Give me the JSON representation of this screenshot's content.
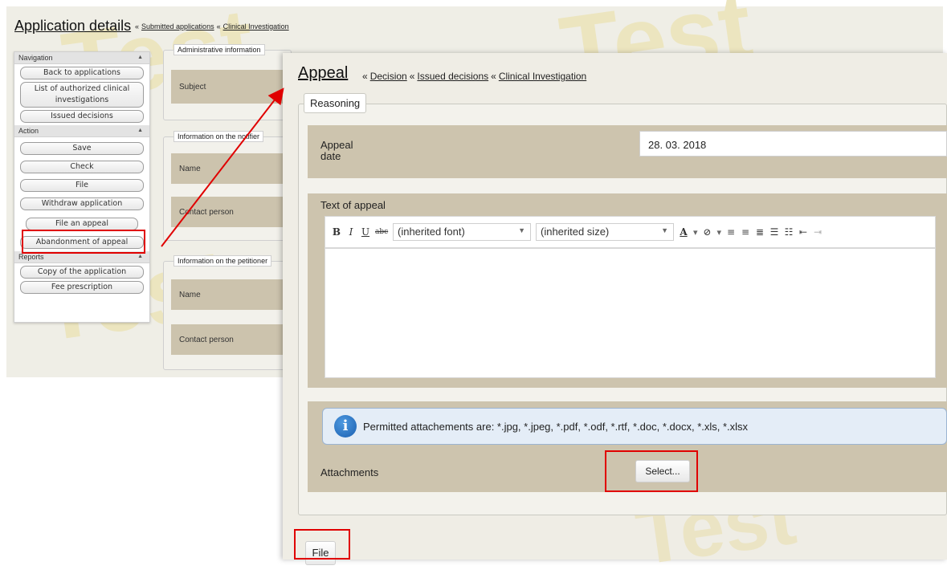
{
  "watermark_text": "Test",
  "app": {
    "title": "Application details",
    "breadcrumbs": [
      "Submitted applications",
      "Clinical Investigation"
    ]
  },
  "sidebar": {
    "sections": [
      {
        "label": "Navigation",
        "buttons": [
          "Back to applications",
          "List of authorized clinical investigations",
          "Issued decisions"
        ]
      },
      {
        "label": "Action",
        "buttons": [
          "Save",
          "Check",
          "File",
          "Withdraw application",
          "File an appeal",
          "Abandonment of appeal"
        ]
      },
      {
        "label": "Reports",
        "buttons": [
          "Copy of the application",
          "Fee prescription"
        ]
      }
    ]
  },
  "bg_panels": [
    {
      "legend": "Administrative information",
      "rows": [
        "Subject"
      ]
    },
    {
      "legend": "Information on the notifier",
      "rows": [
        "Name",
        "Contact person"
      ]
    },
    {
      "legend": "Information on the petitioner",
      "rows": [
        "Name",
        "Contact person"
      ]
    }
  ],
  "appeal": {
    "title": "Appeal",
    "breadcrumbs": [
      "Decision",
      "Issued decisions",
      "Clinical Investigation"
    ],
    "tab": "Reasoning",
    "date_label": "Appeal date",
    "date_value": "28. 03. 2018",
    "text_label": "Text of appeal",
    "toolbar": {
      "bold": "B",
      "italic": "I",
      "underline": "U",
      "strike": "abc",
      "font": "(inherited font)",
      "size": "(inherited size)"
    },
    "info": "Permitted attachements are: *.jpg, *.jpeg, *.pdf, *.odf, *.rtf, *.doc, *.docx, *.xls, *.xlsx",
    "attachments_label": "Attachments",
    "select_label": "Select...",
    "file_label": "File"
  },
  "colors": {
    "highlight": "#e00000",
    "panel_tan": "#cdc4ae",
    "info_bg": "#e4edf7"
  }
}
